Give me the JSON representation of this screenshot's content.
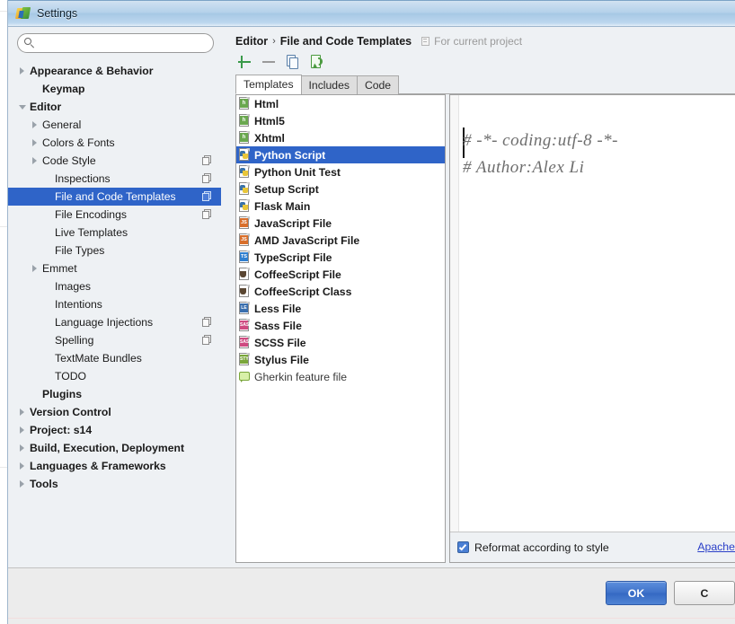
{
  "window": {
    "title": "Settings",
    "icon": "pycharm-logo-icon"
  },
  "search": {
    "value": "",
    "placeholder": "",
    "icon": "search-icon"
  },
  "sidebar": {
    "items": [
      {
        "label": "Appearance & Behavior",
        "indent": 0,
        "bold": true,
        "twisty": "right",
        "badge": false
      },
      {
        "label": "Keymap",
        "indent": 1,
        "bold": true,
        "twisty": "none",
        "badge": false
      },
      {
        "label": "Editor",
        "indent": 0,
        "bold": true,
        "twisty": "down",
        "badge": false
      },
      {
        "label": "General",
        "indent": 1,
        "bold": false,
        "twisty": "right",
        "badge": false
      },
      {
        "label": "Colors & Fonts",
        "indent": 1,
        "bold": false,
        "twisty": "right",
        "badge": false
      },
      {
        "label": "Code Style",
        "indent": 1,
        "bold": false,
        "twisty": "right",
        "badge": true
      },
      {
        "label": "Inspections",
        "indent": 2,
        "bold": false,
        "twisty": "none",
        "badge": true
      },
      {
        "label": "File and Code Templates",
        "indent": 2,
        "bold": false,
        "twisty": "none",
        "badge": true,
        "selected": true
      },
      {
        "label": "File Encodings",
        "indent": 2,
        "bold": false,
        "twisty": "none",
        "badge": true
      },
      {
        "label": "Live Templates",
        "indent": 2,
        "bold": false,
        "twisty": "none",
        "badge": false
      },
      {
        "label": "File Types",
        "indent": 2,
        "bold": false,
        "twisty": "none",
        "badge": false
      },
      {
        "label": "Emmet",
        "indent": 1,
        "bold": false,
        "twisty": "right",
        "badge": false
      },
      {
        "label": "Images",
        "indent": 2,
        "bold": false,
        "twisty": "none",
        "badge": false
      },
      {
        "label": "Intentions",
        "indent": 2,
        "bold": false,
        "twisty": "none",
        "badge": false
      },
      {
        "label": "Language Injections",
        "indent": 2,
        "bold": false,
        "twisty": "none",
        "badge": true
      },
      {
        "label": "Spelling",
        "indent": 2,
        "bold": false,
        "twisty": "none",
        "badge": true
      },
      {
        "label": "TextMate Bundles",
        "indent": 2,
        "bold": false,
        "twisty": "none",
        "badge": false
      },
      {
        "label": "TODO",
        "indent": 2,
        "bold": false,
        "twisty": "none",
        "badge": false
      },
      {
        "label": "Plugins",
        "indent": 1,
        "bold": true,
        "twisty": "none",
        "badge": false
      },
      {
        "label": "Version Control",
        "indent": 0,
        "bold": true,
        "twisty": "right",
        "badge": false
      },
      {
        "label": "Project: s14",
        "indent": 0,
        "bold": true,
        "twisty": "right",
        "badge": false
      },
      {
        "label": "Build, Execution, Deployment",
        "indent": 0,
        "bold": true,
        "twisty": "right",
        "badge": false
      },
      {
        "label": "Languages & Frameworks",
        "indent": 0,
        "bold": true,
        "twisty": "right",
        "badge": false
      },
      {
        "label": "Tools",
        "indent": 0,
        "bold": true,
        "twisty": "right",
        "badge": false
      }
    ]
  },
  "breadcrumb": {
    "parent": "Editor",
    "separator": "›",
    "current": "File and Code Templates",
    "scope_note": "For current project",
    "scope_icon": "copy-scope-icon"
  },
  "toolbar": {
    "add_label": "+",
    "remove_label": "−",
    "copy_name": "copy-template-icon",
    "reset_name": "reset-to-default-icon"
  },
  "tabs": [
    {
      "label": "Templates",
      "active": true
    },
    {
      "label": "Includes",
      "active": false
    },
    {
      "label": "Code",
      "active": false
    }
  ],
  "templates": [
    {
      "label": "Html",
      "icon": "html-file-icon",
      "tag": "h",
      "kind": "html",
      "bold": true
    },
    {
      "label": "Html5",
      "icon": "html5-file-icon",
      "tag": "h",
      "kind": "html",
      "bold": true
    },
    {
      "label": "Xhtml",
      "icon": "xhtml-file-icon",
      "tag": "h",
      "kind": "html",
      "bold": true
    },
    {
      "label": "Python Script",
      "icon": "python-file-icon",
      "tag": "",
      "kind": "py",
      "bold": true,
      "selected": true
    },
    {
      "label": "Python Unit Test",
      "icon": "python-file-icon",
      "tag": "",
      "kind": "py",
      "bold": true
    },
    {
      "label": "Setup Script",
      "icon": "python-file-icon",
      "tag": "",
      "kind": "py",
      "bold": true
    },
    {
      "label": "Flask Main",
      "icon": "python-file-icon",
      "tag": "",
      "kind": "py",
      "bold": true
    },
    {
      "label": "JavaScript File",
      "icon": "javascript-file-icon",
      "tag": "JS",
      "kind": "js",
      "bold": true
    },
    {
      "label": "AMD JavaScript File",
      "icon": "javascript-file-icon",
      "tag": "JS",
      "kind": "js",
      "bold": true
    },
    {
      "label": "TypeScript File",
      "icon": "typescript-file-icon",
      "tag": "TS",
      "kind": "ts",
      "bold": true
    },
    {
      "label": "CoffeeScript File",
      "icon": "coffeescript-file-icon",
      "tag": "",
      "kind": "coffee",
      "bold": true
    },
    {
      "label": "CoffeeScript Class",
      "icon": "coffeescript-file-icon",
      "tag": "",
      "kind": "coffee",
      "bold": true
    },
    {
      "label": "Less File",
      "icon": "less-file-icon",
      "tag": "LE",
      "kind": "less",
      "bold": true
    },
    {
      "label": "Sass File",
      "icon": "sass-file-icon",
      "tag": "SASS",
      "kind": "sass",
      "bold": true
    },
    {
      "label": "SCSS File",
      "icon": "scss-file-icon",
      "tag": "SASS",
      "kind": "sass",
      "bold": true
    },
    {
      "label": "Stylus File",
      "icon": "stylus-file-icon",
      "tag": "STYL",
      "kind": "styl",
      "bold": true
    },
    {
      "label": "Gherkin feature file",
      "icon": "gherkin-file-icon",
      "tag": "",
      "kind": "gherkin",
      "bold": false
    }
  ],
  "editor": {
    "content": "# -*- coding:utf-8 -*-\n# Author:Alex Li",
    "caret_visible": true
  },
  "editor_footer": {
    "reformat_label": "Reformat according to style",
    "reformat_checked": true,
    "link_label": "Apache"
  },
  "dialog_buttons": {
    "ok_label": "OK",
    "cancel_label": "C"
  },
  "colors": {
    "selection_blue": "#2f64c8",
    "titlebar_blue": "#a6c8e4",
    "link_blue": "#2a3fc8",
    "ok_button_blue": "#3f72c9",
    "add_green": "#3a9a4a"
  }
}
